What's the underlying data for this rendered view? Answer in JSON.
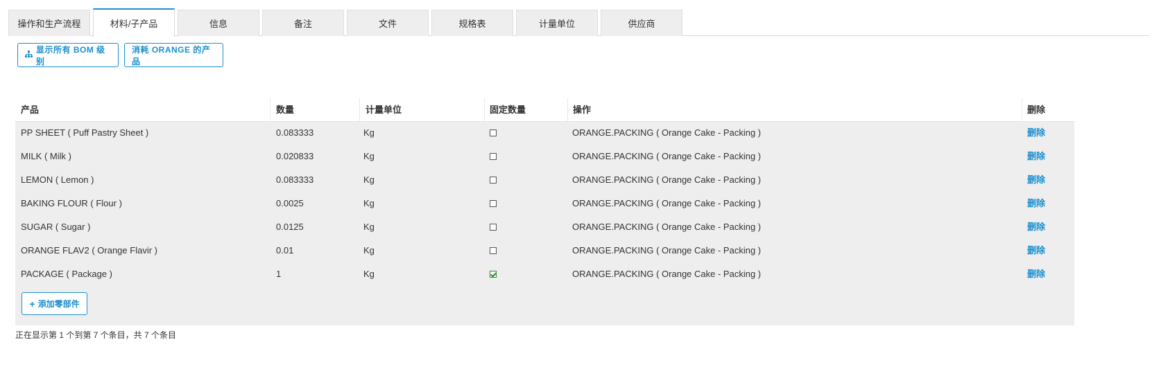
{
  "tabs": [
    {
      "label": "操作和生产流程"
    },
    {
      "label": "材料/子产品"
    },
    {
      "label": "信息"
    },
    {
      "label": "备注"
    },
    {
      "label": "文件"
    },
    {
      "label": "规格表"
    },
    {
      "label": "计量单位"
    },
    {
      "label": "供应商"
    }
  ],
  "active_tab_index": 1,
  "actions": {
    "show_bom_label": "显示所有 BOM 级别",
    "consume_label": "消耗 ORANGE 的产品"
  },
  "table": {
    "headers": {
      "product": "产品",
      "quantity": "数量",
      "uom": "计量单位",
      "fixed_qty": "固定数量",
      "operation": "操作",
      "delete": "删除"
    },
    "rows": [
      {
        "product": "PP SHEET ( Puff Pastry Sheet )",
        "quantity": "0.083333",
        "uom": "Kg",
        "fixed": false,
        "operation": "ORANGE.PACKING ( Orange Cake - Packing )",
        "delete": "删除"
      },
      {
        "product": "MILK ( Milk )",
        "quantity": "0.020833",
        "uom": "Kg",
        "fixed": false,
        "operation": "ORANGE.PACKING ( Orange Cake - Packing )",
        "delete": "删除"
      },
      {
        "product": "LEMON ( Lemon )",
        "quantity": "0.083333",
        "uom": "Kg",
        "fixed": false,
        "operation": "ORANGE.PACKING ( Orange Cake - Packing )",
        "delete": "删除"
      },
      {
        "product": "BAKING FLOUR ( Flour )",
        "quantity": "0.0025",
        "uom": "Kg",
        "fixed": false,
        "operation": "ORANGE.PACKING ( Orange Cake - Packing )",
        "delete": "删除"
      },
      {
        "product": "SUGAR ( Sugar )",
        "quantity": "0.0125",
        "uom": "Kg",
        "fixed": false,
        "operation": "ORANGE.PACKING ( Orange Cake - Packing )",
        "delete": "删除"
      },
      {
        "product": "ORANGE FLAV2 ( Orange Flavir )",
        "quantity": "0.01",
        "uom": "Kg",
        "fixed": false,
        "operation": "ORANGE.PACKING ( Orange Cake - Packing )",
        "delete": "删除"
      },
      {
        "product": "PACKAGE ( Package )",
        "quantity": "1",
        "uom": "Kg",
        "fixed": true,
        "operation": "ORANGE.PACKING ( Orange Cake - Packing )",
        "delete": "删除"
      }
    ],
    "add_part_label": "添加零部件"
  },
  "footer": {
    "info": "正在显示第 1 个到第 7 个条目，共 7 个条目"
  },
  "colors": {
    "accent": "#1a8fcf",
    "row_bg": "#eeeeee",
    "check": "#2b8a2b"
  },
  "icons": {
    "show_bom": "sitemap-icon",
    "add": "plus-icon",
    "fixed_checked": "checkbox-checked-icon",
    "fixed_unchecked": "checkbox-icon"
  }
}
